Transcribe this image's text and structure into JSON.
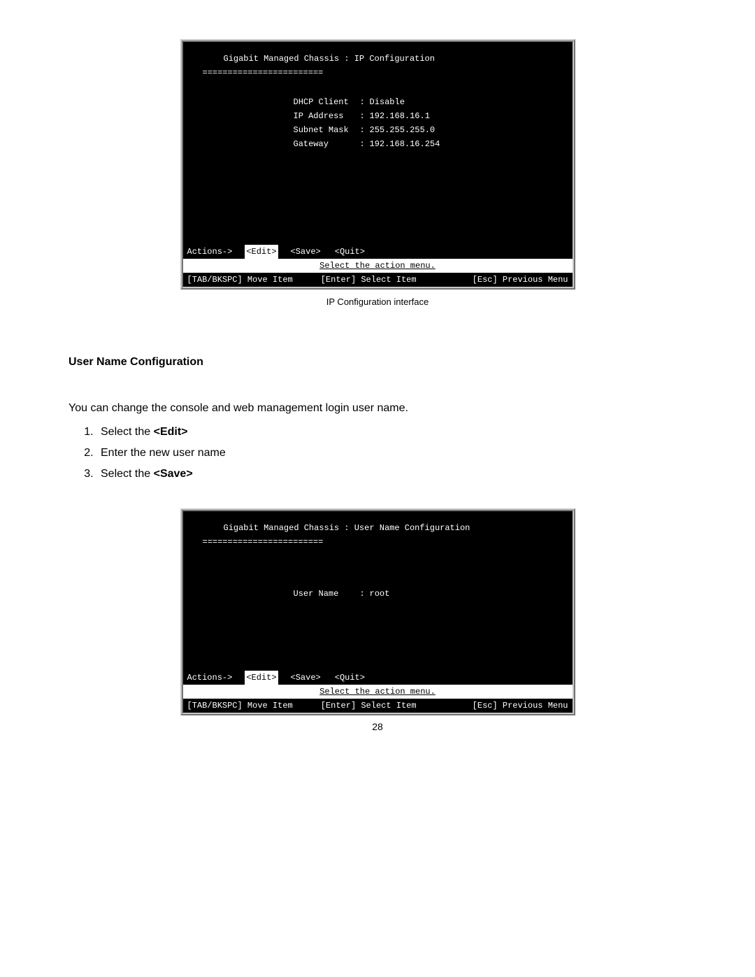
{
  "terminal1": {
    "title": "Gigabit Managed Chassis : IP Configuration",
    "underline": "========================",
    "fields": [
      {
        "label": "DHCP Client",
        "value": "Disable"
      },
      {
        "label": "IP Address ",
        "value": "192.168.16.1"
      },
      {
        "label": "Subnet Mask",
        "value": "255.255.255.0"
      },
      {
        "label": "Gateway    ",
        "value": "192.168.16.254"
      }
    ],
    "actions": {
      "prefix": "Actions->",
      "edit": "<Edit>",
      "save": "<Save>",
      "quit": "<Quit>",
      "hint": "Select the action menu.",
      "footer_left": "[TAB/BKSPC] Move Item",
      "footer_mid": "[Enter] Select Item",
      "footer_right": "[Esc] Previous Menu"
    }
  },
  "caption1": "IP Configuration interface",
  "section_heading": "User Name Configuration",
  "paragraph": "You can change the console and web management login user name.",
  "steps": {
    "s1_a": "Select the ",
    "s1_b": "<Edit>",
    "s2": "Enter the new user name",
    "s3_a": "Select the ",
    "s3_b": "<Save>"
  },
  "terminal2": {
    "title": "Gigabit Managed Chassis : User Name Configuration",
    "underline": "========================",
    "field_label": "User Name",
    "field_value": "root",
    "actions": {
      "prefix": "Actions->",
      "edit": "<Edit>",
      "save": "<Save>",
      "quit": "<Quit>",
      "hint": "Select the action menu.",
      "footer_left": "[TAB/BKSPC] Move Item",
      "footer_mid": "[Enter] Select Item",
      "footer_right": "[Esc] Previous Menu"
    }
  },
  "page_number": "28"
}
